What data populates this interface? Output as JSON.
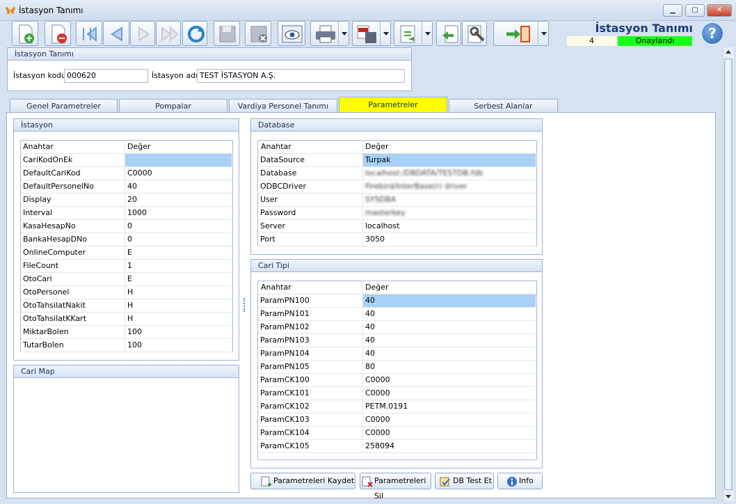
{
  "window": {
    "title": "İstasyon Tanımı"
  },
  "header": {
    "title": "İstasyon Tanımı",
    "count": "4",
    "status": "Onaylandı",
    "status_color": "#18ff18"
  },
  "toolbar": [
    {
      "name": "new-icon"
    },
    {
      "name": "delete-icon"
    },
    {
      "name": "first-icon"
    },
    {
      "name": "prev-icon"
    },
    {
      "name": "next-icon"
    },
    {
      "name": "last-icon"
    },
    {
      "name": "refresh-icon"
    },
    {
      "name": "save-icon"
    },
    {
      "name": "cancel-save-icon"
    },
    {
      "name": "preview-icon"
    },
    {
      "name": "print-icon"
    },
    {
      "name": "pdf-save-icon"
    },
    {
      "name": "export-icon"
    },
    {
      "name": "import-icon"
    },
    {
      "name": "settings-icon"
    },
    {
      "name": "exit-icon"
    }
  ],
  "station": {
    "group_title": "İstasyon Tanımı",
    "code_label": "İstasyon kodu",
    "code_value": "000620",
    "name_label": "İstasyon adı",
    "name_value": "TEST İSTASYON A.Ş."
  },
  "tabs": [
    "Genel Parametreler",
    "Pompalar",
    "Vardiya Personel Tanımı",
    "Parametreler",
    "Serbest Alanlar"
  ],
  "istasyon": {
    "title": "İstasyon",
    "columns": [
      "Anahtar",
      "Değer"
    ],
    "rows": [
      [
        "CariKodOnEk",
        ""
      ],
      [
        "DefaultCariKod",
        "C0000"
      ],
      [
        "DefaultPersonelNo",
        "40"
      ],
      [
        "Display",
        "20"
      ],
      [
        "Interval",
        "1000"
      ],
      [
        "KasaHesapNo",
        "0"
      ],
      [
        "BankaHesapDNo",
        "0"
      ],
      [
        "OnlineComputer",
        "E"
      ],
      [
        "FileCount",
        "1"
      ],
      [
        "OtoCari",
        "E"
      ],
      [
        "OtoPersonel",
        "H"
      ],
      [
        "OtoTahsilatNakit",
        "H"
      ],
      [
        "OtoTahsilatKKart",
        "H"
      ],
      [
        "MiktarBolen",
        "100"
      ],
      [
        "TutarBolen",
        "100"
      ]
    ]
  },
  "cari_map": {
    "title": "Cari Map"
  },
  "database": {
    "title": "Database",
    "columns": [
      "Anahtar",
      "Değer"
    ],
    "rows": [
      [
        "DataSource",
        "Turpak"
      ],
      [
        "Database",
        "localhost:/DBDATA/TESTDB.fdb"
      ],
      [
        "ODBCDriver",
        "Firebird/InterBase(r) driver"
      ],
      [
        "User",
        "SYSDBA"
      ],
      [
        "Password",
        "masterkey"
      ],
      [
        "Server",
        "localhost"
      ],
      [
        "Port",
        "3050"
      ]
    ]
  },
  "cari_tipi": {
    "title": "Cari Tipi",
    "columns": [
      "Anahtar",
      "Değer"
    ],
    "rows": [
      [
        "ParamPN100",
        "40"
      ],
      [
        "ParamPN101",
        "40"
      ],
      [
        "ParamPN102",
        "40"
      ],
      [
        "ParamPN103",
        "40"
      ],
      [
        "ParamPN104",
        "40"
      ],
      [
        "ParamPN105",
        "80"
      ],
      [
        "ParamCK100",
        "C0000"
      ],
      [
        "ParamCK101",
        "C0000"
      ],
      [
        "ParamCK102",
        "PETM.0191"
      ],
      [
        "ParamCK103",
        "C0000"
      ],
      [
        "ParamCK104",
        "C0000"
      ],
      [
        "ParamCK105",
        "258094"
      ]
    ]
  },
  "buttons": {
    "save": "Parametreleri Kaydet",
    "delete": "Parametreleri Sil",
    "dbtest": "DB Test Et",
    "info": "Info"
  }
}
